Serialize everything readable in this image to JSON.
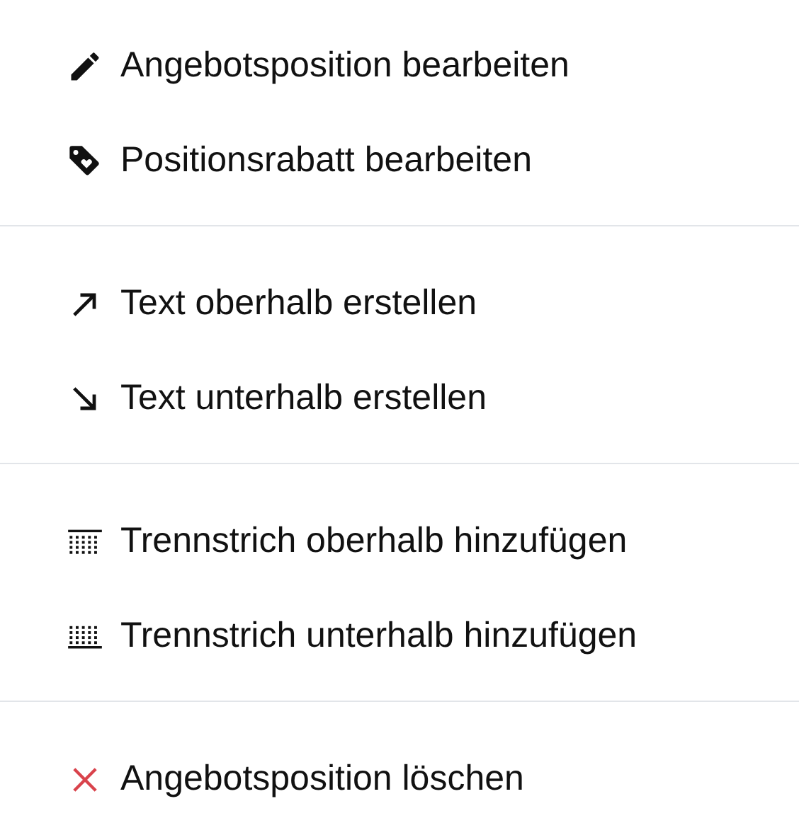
{
  "groups": [
    {
      "items": [
        {
          "kind": "edit",
          "label": "Angebotsposition bearbeiten"
        },
        {
          "kind": "discount",
          "label": "Positionsrabatt bearbeiten"
        }
      ]
    },
    {
      "items": [
        {
          "kind": "above",
          "label": "Text oberhalb erstellen"
        },
        {
          "kind": "below",
          "label": "Text unterhalb erstellen"
        }
      ]
    },
    {
      "items": [
        {
          "kind": "rule-above",
          "label": "Trennstrich oberhalb hinzufügen"
        },
        {
          "kind": "rule-below",
          "label": "Trennstrich unterhalb hinzufügen"
        }
      ]
    },
    {
      "items": [
        {
          "kind": "delete",
          "label": "Angebotsposition löschen"
        }
      ]
    }
  ]
}
